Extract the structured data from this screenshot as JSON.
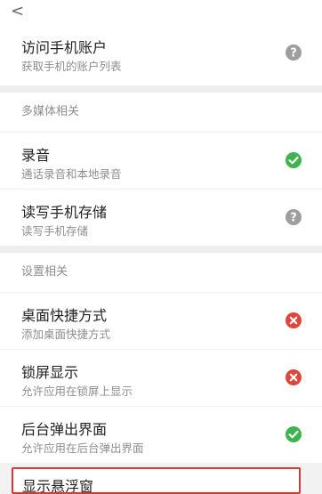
{
  "topbar": {
    "back": "<",
    "title": ""
  },
  "items": {
    "account": {
      "title": "访问手机账户",
      "subtitle": "获取手机的账户列表",
      "status": "unknown"
    },
    "media_header": "多媒体相关",
    "record": {
      "title": "录音",
      "subtitle": "通话录音和本地录音",
      "status": "allowed"
    },
    "storage": {
      "title": "读写手机存储",
      "subtitle": "读写手机存储",
      "status": "unknown"
    },
    "settings_header": "设置相关",
    "shortcut": {
      "title": "桌面快捷方式",
      "subtitle": "添加桌面快捷方式",
      "status": "denied"
    },
    "lockscreen": {
      "title": "锁屏显示",
      "subtitle": "允许应用在锁屏上显示",
      "status": "denied"
    },
    "popup": {
      "title": "后台弹出界面",
      "subtitle": "允许应用在后台弹出界面",
      "status": "allowed"
    },
    "float": {
      "title": "显示悬浮窗"
    }
  },
  "colors": {
    "allowed": "#3fb34f",
    "denied": "#e0453a",
    "unknown": "#9e9e9e"
  }
}
